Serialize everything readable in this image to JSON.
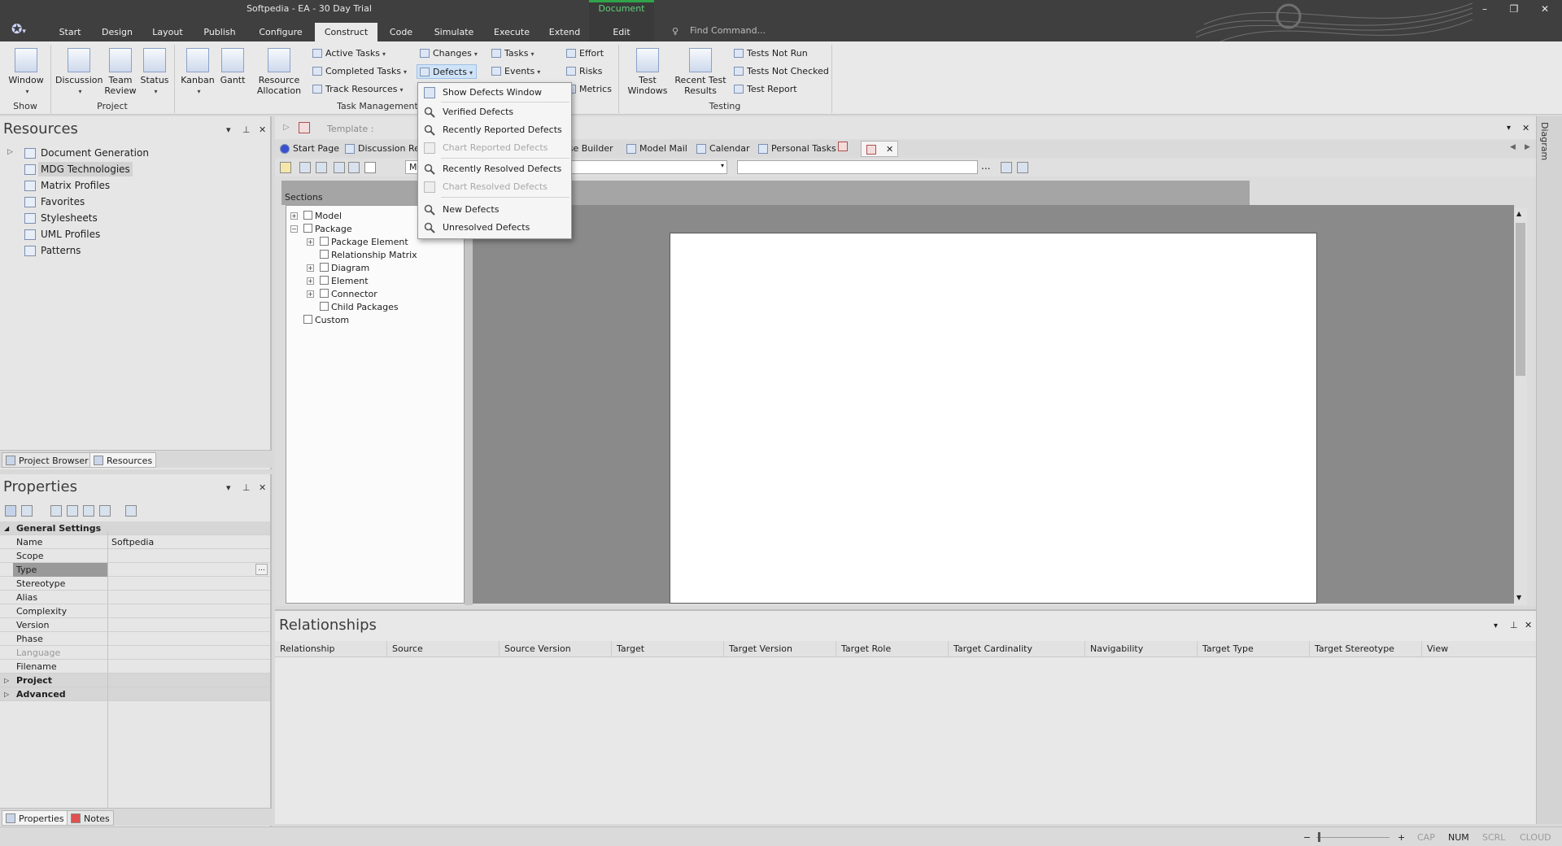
{
  "window": {
    "title": "Softpedia - EA - 30 Day Trial",
    "context_tab": "Document",
    "find_placeholder": "Find Command...",
    "controls": [
      "–",
      "❐",
      "✕"
    ]
  },
  "menu_tabs": [
    "Start",
    "Design",
    "Layout",
    "Publish",
    "Configure",
    "Construct",
    "Code",
    "Simulate",
    "Execute",
    "Extend",
    "Edit"
  ],
  "active_tab": "Construct",
  "ribbon": {
    "show": {
      "window_label": "Window",
      "group": "Show"
    },
    "project": {
      "discussion": "Discussion",
      "team_review": "Team Review",
      "status": "Status",
      "group": "Project"
    },
    "task_mgmt": {
      "kanban": "Kanban",
      "gantt": "Gantt",
      "resource_allocation": "Resource Allocation",
      "active_tasks": "Active Tasks",
      "completed_tasks": "Completed Tasks",
      "track_resources": "Track Resources",
      "changes": "Changes",
      "defects": "Defects",
      "tasks": "Tasks",
      "events": "Events",
      "effort": "Effort",
      "risks": "Risks",
      "metrics": "Metrics",
      "group": "Task Management"
    },
    "testing": {
      "test_windows": "Test Windows",
      "recent_test_results": "Recent Test Results",
      "tests_not_run": "Tests Not Run",
      "tests_not_checked": "Tests Not Checked",
      "test_report": "Test Report",
      "group": "Testing"
    }
  },
  "defects_menu": {
    "items": [
      {
        "label": "Show Defects Window",
        "enabled": true
      },
      {
        "label": "Verified Defects",
        "enabled": true
      },
      {
        "label": "Recently Reported Defects",
        "enabled": true
      },
      {
        "label": "Chart Reported Defects",
        "enabled": false
      },
      {
        "label": "Recently Resolved Defects",
        "enabled": true
      },
      {
        "label": "Chart Resolved Defects",
        "enabled": false
      },
      {
        "label": "New Defects",
        "enabled": true
      },
      {
        "label": "Unresolved Defects",
        "enabled": true
      }
    ]
  },
  "resources": {
    "title": "Resources",
    "items": [
      "Document Generation",
      "MDG Technologies",
      "Matrix Profiles",
      "Favorites",
      "Stylesheets",
      "UML Profiles",
      "Patterns"
    ],
    "selected": "MDG Technologies",
    "tabs": [
      "Project Browser",
      "Resources"
    ]
  },
  "properties": {
    "title": "Properties",
    "section": "General Settings",
    "rows": [
      {
        "key": "Name",
        "value": "Softpedia"
      },
      {
        "key": "Scope",
        "value": ""
      },
      {
        "key": "Type",
        "value": ""
      },
      {
        "key": "Stereotype",
        "value": ""
      },
      {
        "key": "Alias",
        "value": ""
      },
      {
        "key": "Complexity",
        "value": ""
      },
      {
        "key": "Version",
        "value": ""
      },
      {
        "key": "Phase",
        "value": ""
      },
      {
        "key": "Language",
        "value": ""
      },
      {
        "key": "Filename",
        "value": ""
      }
    ],
    "collapsed_sections": [
      "Project",
      "Advanced"
    ],
    "tabs": [
      "Properties",
      "Notes"
    ],
    "ellipsis": "..."
  },
  "document": {
    "template_label": "Template :",
    "tabs": [
      "Start Page",
      "Discussion Re",
      "ase Builder",
      "Model Mail",
      "Calendar",
      "Personal Tasks"
    ],
    "combo_value": "M",
    "ellipsis": "...",
    "sections_label": "Sections",
    "sections": [
      {
        "label": "Model",
        "level": 0,
        "expander": "+"
      },
      {
        "label": "Package",
        "level": 0,
        "expander": "−"
      },
      {
        "label": "Package Element",
        "level": 1,
        "expander": "+"
      },
      {
        "label": "Relationship Matrix",
        "level": 1,
        "expander": ""
      },
      {
        "label": "Diagram",
        "level": 1,
        "expander": "+"
      },
      {
        "label": "Element",
        "level": 1,
        "expander": "+"
      },
      {
        "label": "Connector",
        "level": 1,
        "expander": "+"
      },
      {
        "label": "Child Packages",
        "level": 1,
        "expander": ""
      },
      {
        "label": "Custom",
        "level": 0,
        "expander": ""
      }
    ]
  },
  "right_strip_label": "Diagram",
  "relationships": {
    "title": "Relationships",
    "columns": [
      "Relationship",
      "Source",
      "Source Version",
      "Target",
      "Target Version",
      "Target Role",
      "Target Cardinality",
      "Navigability",
      "Target Type",
      "Target Stereotype",
      "View"
    ]
  },
  "statusbar": {
    "indicators": [
      {
        "label": "CAP",
        "on": false
      },
      {
        "label": "NUM",
        "on": true
      },
      {
        "label": "SCRL",
        "on": false
      },
      {
        "label": "CLOUD",
        "on": false
      }
    ],
    "zoom_minus": "−",
    "zoom_plus": "+"
  },
  "colors": {
    "titlebar": "#3f3f3f",
    "ribbon": "#e9e9e9",
    "context_green": "#2fa44a",
    "page_bg": "#8a8a8a"
  }
}
